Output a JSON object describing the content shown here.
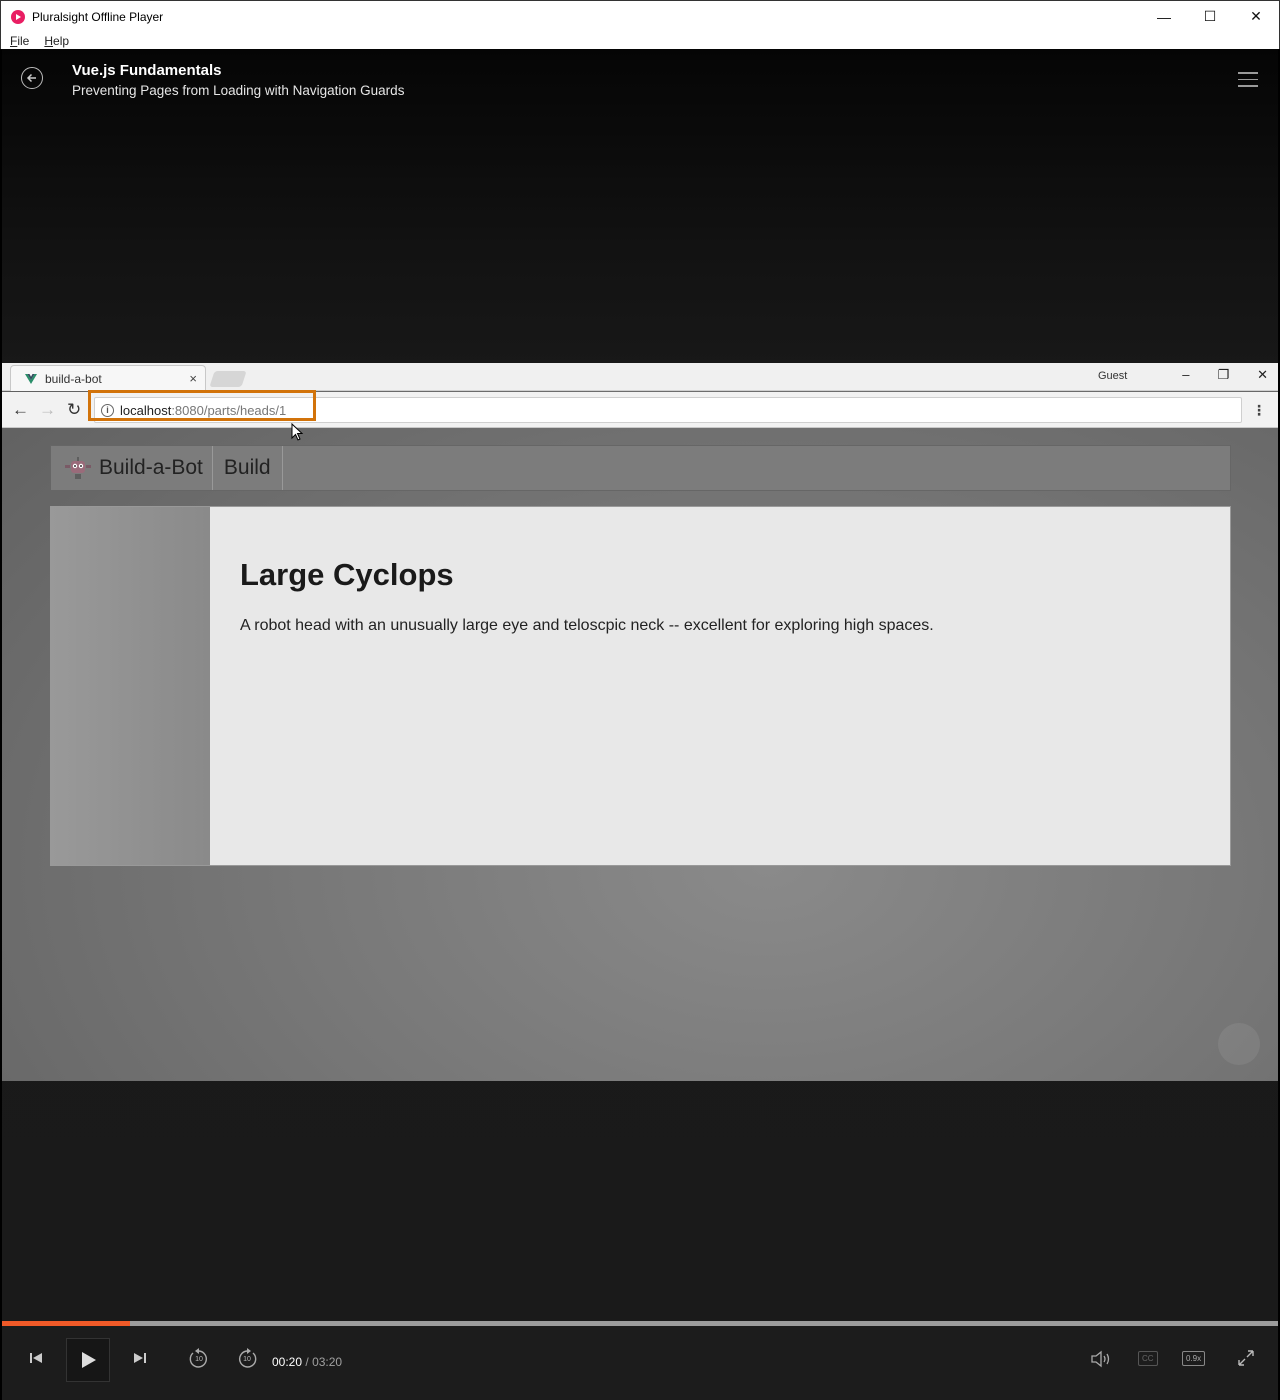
{
  "window": {
    "title": "Pluralsight Offline Player",
    "controls": {
      "minimize": "—",
      "maximize": "☐",
      "close": "✕"
    }
  },
  "menubar": {
    "file": {
      "accel": "F",
      "rest": "ile"
    },
    "help": {
      "accel": "H",
      "rest": "elp"
    }
  },
  "player": {
    "course_title": "Vue.js Fundamentals",
    "clip_title": "Preventing Pages from Loading with Navigation Guards"
  },
  "browser": {
    "tab_title": "build-a-bot",
    "tab_close": "×",
    "guest_label": "Guest",
    "url_host": "localhost",
    "url_path": ":8080/parts/heads/1",
    "window_controls": {
      "minimize": "–",
      "restore": "❐",
      "close": "✕"
    }
  },
  "app": {
    "brand": "Build-a-Bot",
    "nav_build": "Build",
    "part_title": "Large Cyclops",
    "part_description": "A robot head with an unusually large eye and teloscpic neck -- excellent for exploring high spaces."
  },
  "controls": {
    "current_time": "00:20",
    "separator": "/",
    "duration": "03:20",
    "progress_fraction": 0.1,
    "rewind_label": "10",
    "forward_label": "10",
    "cc_label": "CC",
    "speed_label": "0.9x",
    "progress_color": "#f05a28",
    "highlight_color": "#d2730a"
  }
}
